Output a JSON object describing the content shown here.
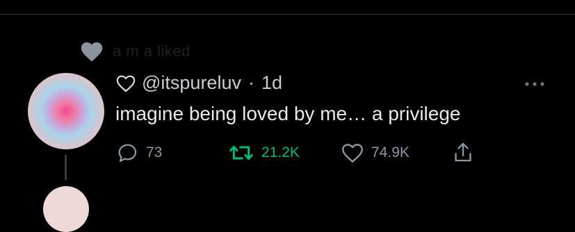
{
  "social_context": {
    "text": "a m a liked"
  },
  "tweet": {
    "handle": "@itspureluv",
    "separator": "·",
    "time": "1d",
    "text": "imagine being loved by me… a privilege"
  },
  "actions": {
    "replies": "73",
    "retweets": "21.2K",
    "likes": "74.9K"
  },
  "colors": {
    "background": "#000000",
    "retweet_green": "#00ba7c",
    "muted": "#8b98a5",
    "text": "#e7e9ea"
  },
  "icons": {
    "social_context": "heart-filled-icon",
    "header": "heart-outline-icon",
    "more": "more-dots-icon",
    "reply": "reply-icon",
    "retweet": "retweet-icon",
    "like": "heart-outline-icon",
    "share": "share-icon"
  }
}
